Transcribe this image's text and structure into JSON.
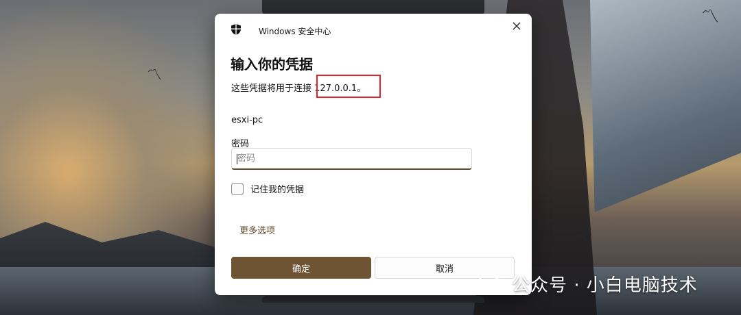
{
  "dialog": {
    "title": "Windows 安全中心",
    "heading": "输入你的凭据",
    "subtitle": "这些凭据将用于连接 127.0.0.1。",
    "username": "esxi-pc",
    "password": {
      "label": "密码",
      "placeholder": "密码",
      "value": ""
    },
    "remember_label": "记住我的凭据",
    "remember_checked": false,
    "more_options": "更多选项",
    "ok_label": "确定",
    "cancel_label": "取消"
  },
  "watermark": {
    "text": "公众号 · 小白电脑技术"
  },
  "colors": {
    "accent": "#6e5433",
    "highlight": "#e8202a"
  },
  "icons": [
    "shield-icon",
    "close-icon",
    "wechat-icon"
  ]
}
